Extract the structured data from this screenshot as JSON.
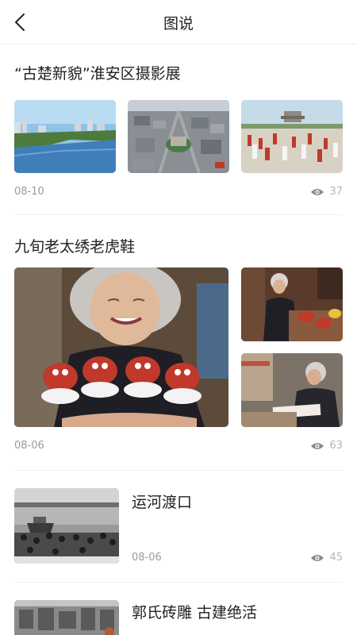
{
  "header": {
    "title": "图说",
    "back_icon": "chevron-left-icon"
  },
  "posts": [
    {
      "title": "“古楚新貌”淮安区摄影展",
      "date": "08-10",
      "views": "37"
    },
    {
      "title": "九旬老太绣老虎鞋",
      "date": "08-06",
      "views": "63"
    },
    {
      "title": "运河渡口",
      "date": "08-06",
      "views": "45"
    },
    {
      "title": "郭氏砖雕  古建绝活"
    }
  ],
  "colors": {
    "text": "#222222",
    "meta": "#9a9a9a",
    "divider": "#f0f0f0"
  }
}
